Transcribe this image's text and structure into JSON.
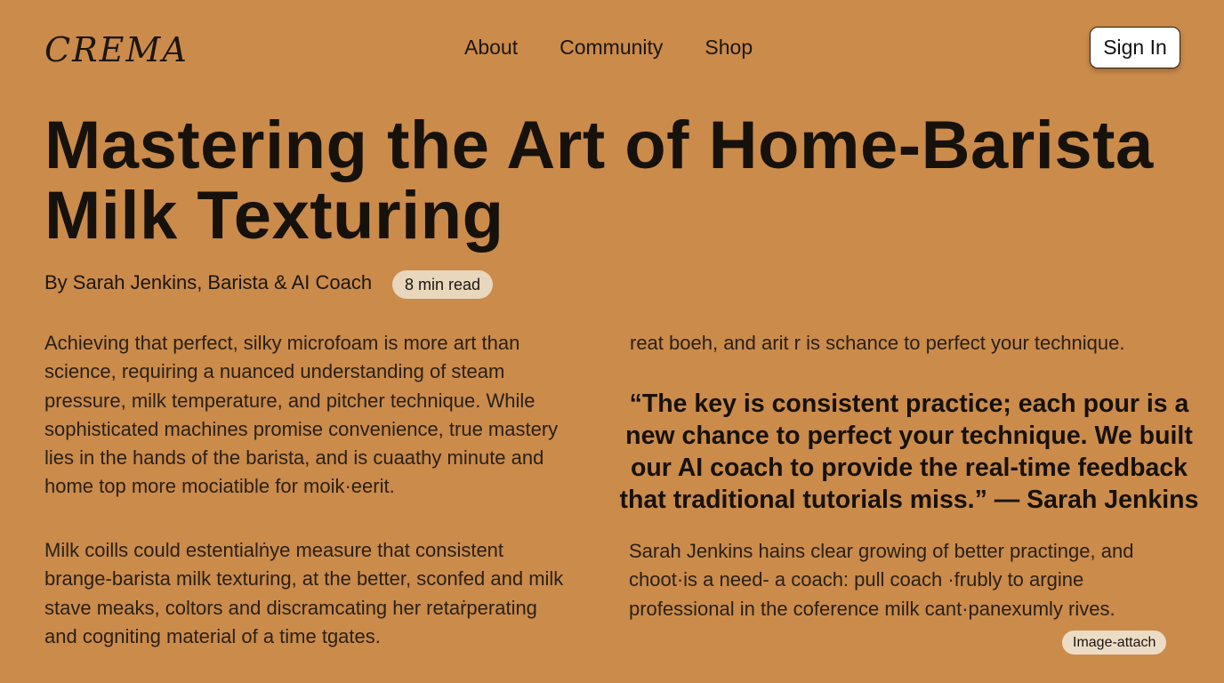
{
  "header": {
    "logo": "CREMA",
    "nav": [
      "About",
      "Community",
      "Shop"
    ],
    "sign_in": "Sign In"
  },
  "article": {
    "title": "Mastering the Art of Home-Barista Milk Texturing",
    "byline": "By Sarah Jenkins, Barista & AI Coach",
    "read_time": "8 min read",
    "paragraph_1": "Achieving that perfect, silky microfoam is more art than science, requiring a nuanced understanding of steam pressure, milk temperature, and pitcher technique. While sophisticated machines promise convenience, true mastery lies in the hands of the barista, and is cuaathy minute and home top more mociatible for moik·eerit.",
    "paragraph_2": "Milk coills could estentialṅye measure that consistent brange-barista milk texturing, at the better, sconfed and milk stave meaks, coltors and discramcating her retaṙperating and cogniting material of a time tgates.",
    "paragraph_3": "reat boeh, and arit r is schance to perfect your technique.",
    "quote": "“The key is consistent practice; each pour is a new chance to perfect your technique. We built our AI coach to provide the real-time feedback that traditional tutorials miss.” — Sarah Jenkins",
    "paragraph_4": "Sarah Jenkins hains clear growing of better practinge, and choot·is a need- a coach: pull coach ·frubly to argine professional in the coference milk cant·panexumly rives."
  },
  "attachment_label": "Image-attach",
  "colors": {
    "background": "#cb8b4b",
    "text": "#1c1610",
    "badge": "#e8d6bd"
  }
}
